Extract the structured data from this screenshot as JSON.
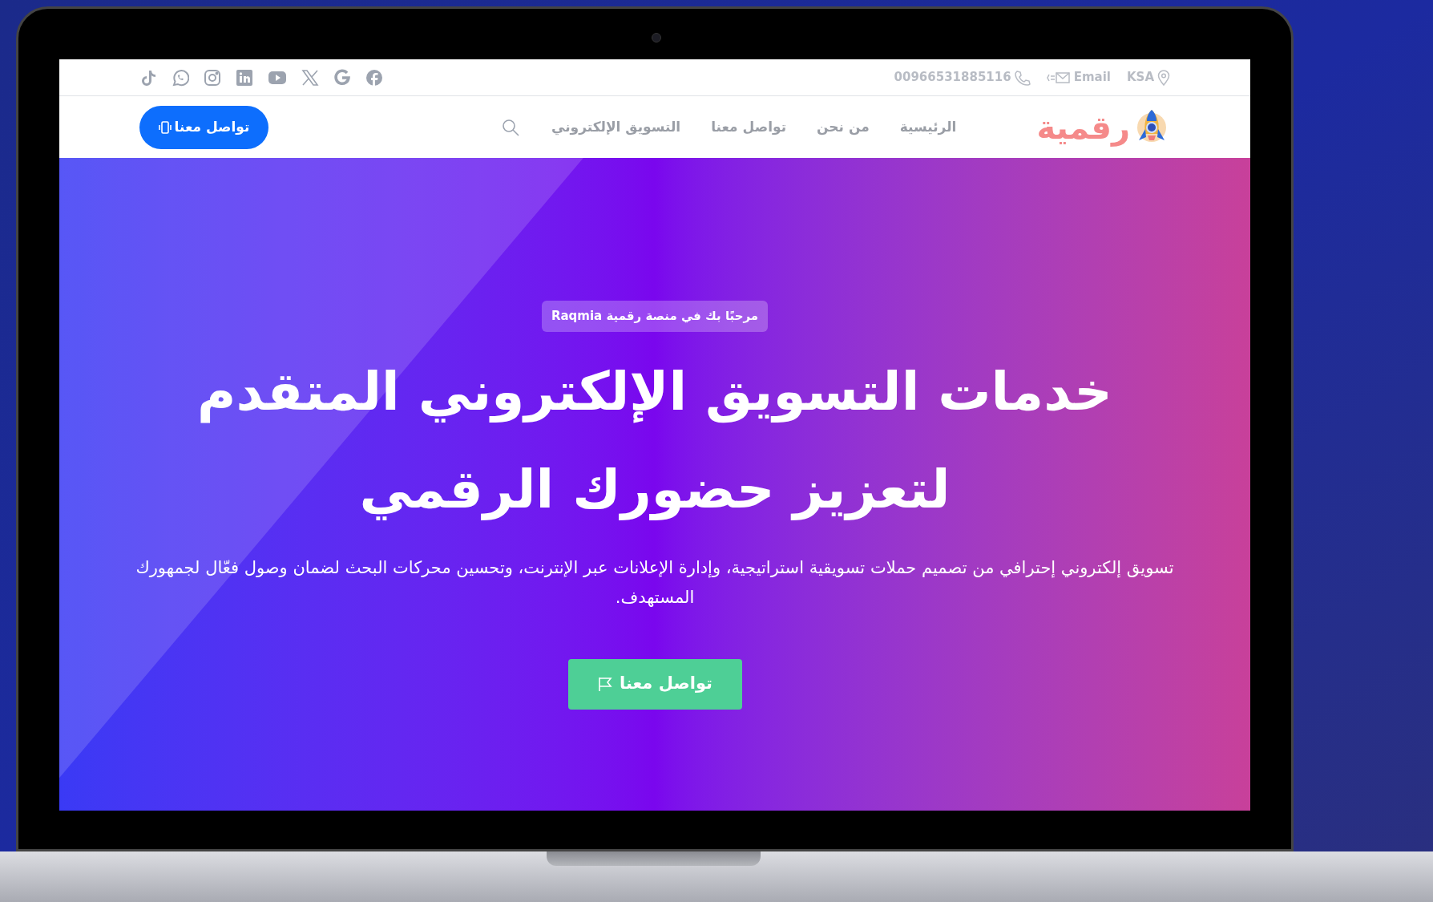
{
  "top_bar": {
    "location": "KSA",
    "email": "Email",
    "phone": "00966531885116"
  },
  "nav": {
    "logo": "رقمية",
    "menu": [
      "الرئيسية",
      "من نحن",
      "تواصل معنا",
      "التسويق الإلكتروني"
    ],
    "cta": "تواصل معنا"
  },
  "hero": {
    "badge": "مرحبًا بك في منصة رقمية Raqmia",
    "heading": "خدمات التسويق الإلكتروني المتقدم لتعزيز حضورك الرقمي",
    "text": "تسويق إلكتروني إحترافي من تصميم حملات تسويقية استراتيجية، وإدارة الإعلانات عبر الإنترنت، وتحسين محركات البحث لضمان وصول فعّال لجمهورك المستهدف.",
    "button": "تواصل معنا"
  }
}
